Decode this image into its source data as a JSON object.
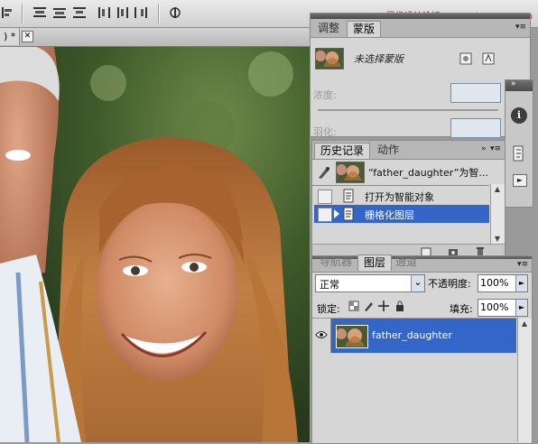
{
  "watermark": "思缘设计论坛 www.missyuan.com",
  "document": {
    "tab_label": ") *",
    "close_label": "✕"
  },
  "adjust_panel": {
    "tabs": [
      "调整",
      "蒙版"
    ],
    "active_tab": 1,
    "mask_label": "未选择蒙版",
    "density_label": "浓度:",
    "feather_label": "羽化:"
  },
  "history_panel": {
    "tabs": [
      "历史记录",
      "动作"
    ],
    "snapshot_label": "“father_daughter”为智...",
    "items": [
      "打开为智能对象",
      "栅格化图层"
    ],
    "selected_index": 1
  },
  "layers_panel": {
    "tabs": [
      "导航器",
      "图层",
      "通道"
    ],
    "blend_mode": "正常",
    "opacity_label": "不透明度:",
    "opacity_value": "100%",
    "lock_label": "锁定:",
    "fill_label": "填充:",
    "fill_value": "100%",
    "layer_name": "father_daughter"
  },
  "icons": {
    "collapse": "»",
    "menu": "▾≡",
    "info": "i",
    "arrow_right": "►",
    "dropdown": "⌄"
  },
  "colors": {
    "selection": "#3466c7",
    "field_bg": "#e0e6ee"
  }
}
